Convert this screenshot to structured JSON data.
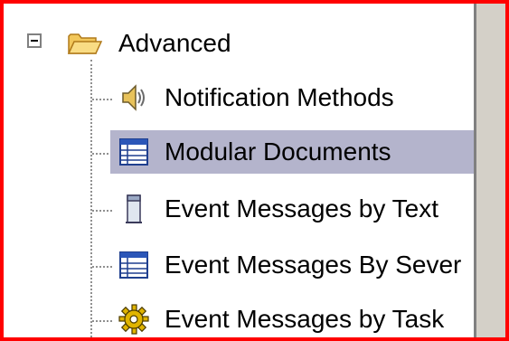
{
  "tree": {
    "root": {
      "label": "Advanced",
      "icon": "open-folder-icon",
      "expanded": true
    },
    "items": [
      {
        "label": "Notification Methods",
        "icon": "speaker-icon",
        "selected": false
      },
      {
        "label": "Modular Documents",
        "icon": "table-icon",
        "selected": true
      },
      {
        "label": "Event Messages by Text",
        "icon": "document-page-icon",
        "selected": false
      },
      {
        "label": "Event Messages By Sever",
        "icon": "table-icon",
        "selected": false
      },
      {
        "label": "Event Messages by Task",
        "icon": "gear-icon",
        "selected": false
      }
    ]
  },
  "colors": {
    "selection": "#b4b4cc",
    "border": "#ff0000",
    "scrollbar": "#d4d0c8"
  }
}
